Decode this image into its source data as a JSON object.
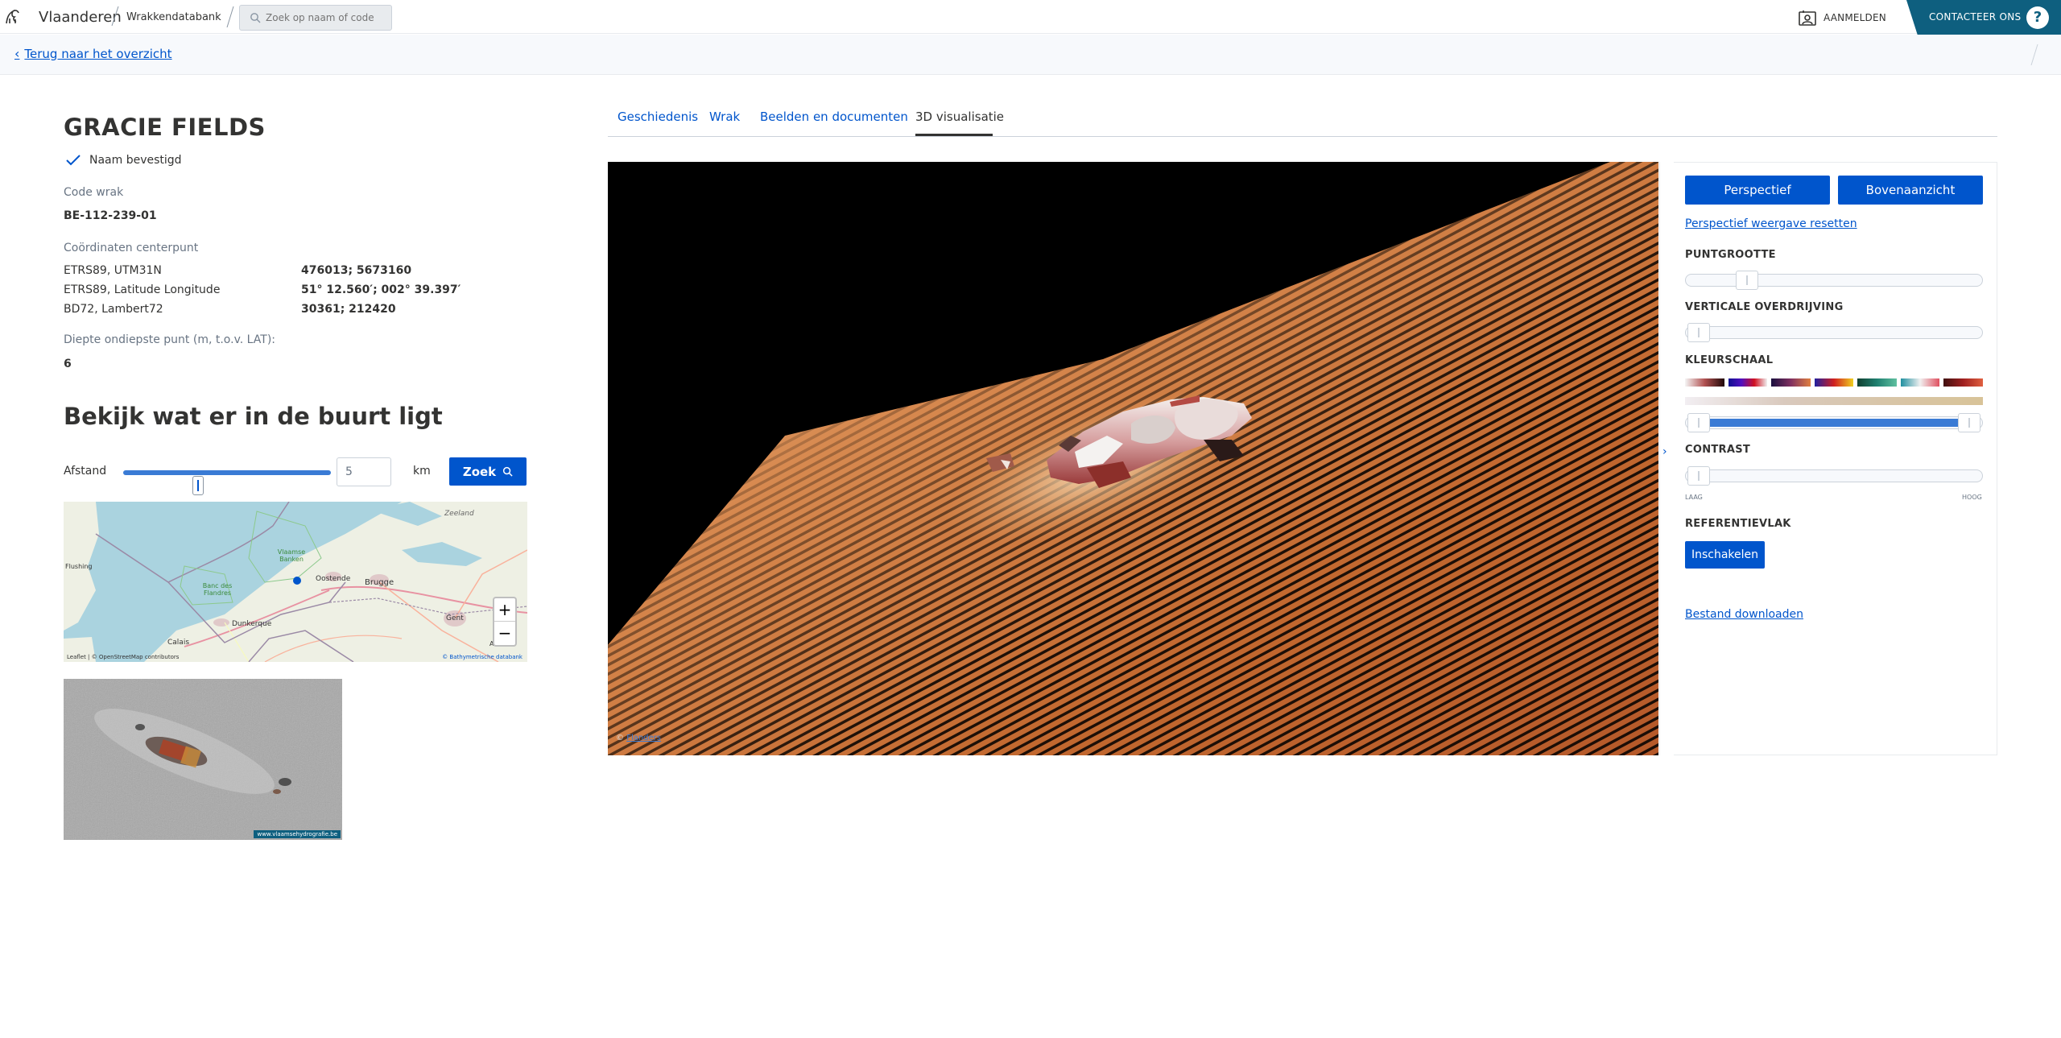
{
  "header": {
    "brand": "Vlaanderen",
    "subbrand": "Wrakkendatabank",
    "search_placeholder": "Zoek op naam of code",
    "login_label": "AANMELDEN",
    "contact_label": "CONTACTEER ONS",
    "help_label": "?"
  },
  "back_link": "Terug naar het overzicht",
  "wreck": {
    "title": "GRACIE FIELDS",
    "name_confirmed": "Naam bevestigd",
    "code_label": "Code wrak",
    "code_value": "BE-112-239-01",
    "coords_label": "Coördinaten centerpunt",
    "coords": [
      {
        "name": "ETRS89, UTM31N",
        "value": "476013; 5673160"
      },
      {
        "name": "ETRS89, Latitude Longitude",
        "value": "51° 12.560′; 002° 39.397′"
      },
      {
        "name": "BD72, Lambert72",
        "value": "30361; 212420"
      }
    ],
    "depth_label": "Diepte ondiepste punt (m, t.o.v. LAT):",
    "depth_value": "6"
  },
  "nearby": {
    "heading": "Bekijk wat er in de buurt ligt",
    "distance_label": "Afstand",
    "distance_value": "5",
    "unit": "km",
    "search_button": "Zoek",
    "map_labels": [
      "Flushing",
      "Vlaamse Banken",
      "Oostende",
      "Brugge",
      "Zeeland",
      "Banc des Flandres",
      "Dunkerque",
      "Calais",
      "Gent",
      "Aalst"
    ],
    "zoom_in": "+",
    "zoom_out": "−",
    "attribution_left": "Leaflet | © OpenStreetMap contributors",
    "attribution_right": "© Bathymetrische databank",
    "sonar_watermark": "www.vlaamsehydrografie.be"
  },
  "tabs": [
    {
      "label": "Geschiedenis",
      "active": false
    },
    {
      "label": "Wrak",
      "active": false
    },
    {
      "label": "Beelden en documenten",
      "active": false
    },
    {
      "label": "3D visualisatie",
      "active": true
    }
  ],
  "viewer": {
    "copyright_prefix": "©",
    "copyright_link": "Flanders"
  },
  "controls": {
    "btn_perspective": "Perspectief",
    "btn_top": "Bovenaanzicht",
    "reset_link": "Perspectief weergave resetten",
    "point_size_label": "PUNTGROOTTE",
    "vertical_label": "VERTICALE OVERDRIJVING",
    "colorscale_label": "KLEURSCHAAL",
    "contrast_label": "CONTRAST",
    "contrast_low": "LAAG",
    "contrast_high": "HOOG",
    "reference_label": "REFERENTIEVLAK",
    "reference_button": "Inschakelen",
    "download_link": "Bestand downloaden",
    "point_size_level": 0.18,
    "vertical_level": 0.0,
    "colorscale_range": [
      0.0,
      1.0
    ],
    "contrast_level": 0.0
  },
  "colors": {
    "accent": "#0055cc",
    "brand_dark": "#0e5f7f",
    "seafloor": "#c8743e"
  }
}
